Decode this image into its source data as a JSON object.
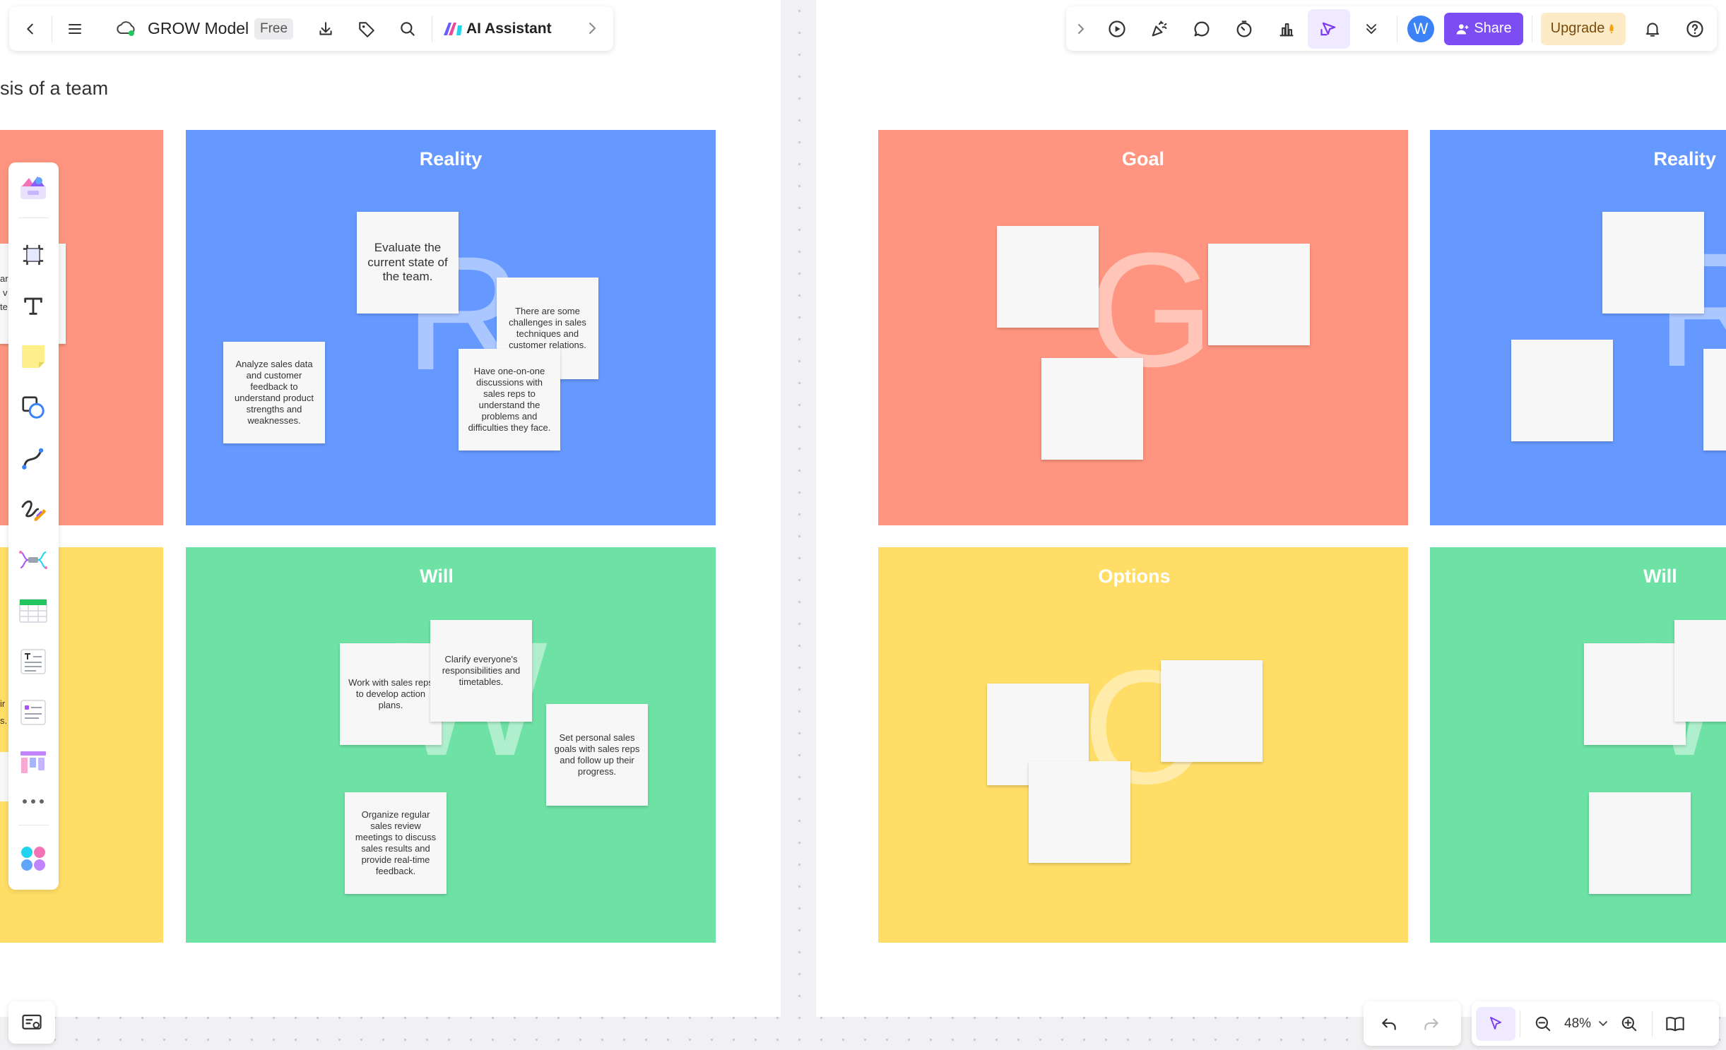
{
  "toolbar_left": {
    "app_title": "GROW Model",
    "plan_badge": "Free",
    "ai_label": "AI Assistant"
  },
  "toolbar_right": {
    "avatar_letter": "W",
    "share_label": "Share",
    "upgrade_label": "Upgrade"
  },
  "left_page": {
    "page_title": "sis of a team",
    "reality": {
      "title": "Reality",
      "letter": "R",
      "notes": [
        "Evaluate the current state of the team.",
        "There are some challenges in sales techniques and customer relations.",
        "Analyze sales data and customer feedback to understand product strengths and weaknesses.",
        "Have one-on-one discussions with sales reps to understand the problems and difficulties they face."
      ]
    },
    "will": {
      "title": "Will",
      "letter": "W",
      "notes": [
        "Work with sales reps to develop action plans.",
        "Clarify everyone's responsibilities and timetables.",
        "Set personal sales goals with sales reps and follow up their progress.",
        "Organize regular sales review meetings to discuss sales results and provide real-time feedback."
      ]
    },
    "partial_text": [
      "ar",
      "v",
      "te",
      "ir",
      "s."
    ]
  },
  "right_page": {
    "goal": {
      "title": "Goal",
      "letter": "G"
    },
    "reality": {
      "title": "Reality",
      "letter": "R"
    },
    "options": {
      "title": "Options",
      "letter": "O"
    },
    "will": {
      "title": "Will",
      "letter": "W"
    }
  },
  "zoom": {
    "level": "48%"
  },
  "colors": {
    "goal": "#FF9580",
    "reality": "#6699FF",
    "options": "#FFDD66",
    "will": "#6EE2A5",
    "accent": "#7C3AED",
    "share": "#7B4DF2",
    "upgrade_bg": "#FDEBC8",
    "avatar": "#3B82F6"
  },
  "icons": {
    "back": "chevron-left-icon",
    "menu": "hamburger-menu-icon",
    "cloud": "cloud-saved-icon",
    "download": "download-icon",
    "tag": "tag-icon",
    "search": "search-icon",
    "ai": "ai-assistant-icon",
    "expand": "chevron-right-icon"
  }
}
